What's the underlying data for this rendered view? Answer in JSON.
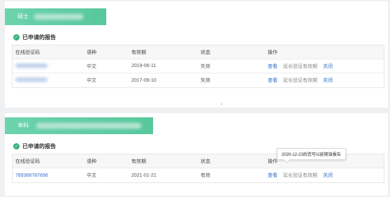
{
  "cards": [
    {
      "degree_label": "硕士",
      "section_title": "已申请的报告",
      "table": {
        "headers": [
          "在线验证码",
          "语种",
          "有效期",
          "状态",
          "操作"
        ],
        "rows": [
          {
            "code": "",
            "language": "中文",
            "valid_until": "2019-06-11",
            "status": "失效",
            "actions": [
              "查看",
              "延长验证有效期",
              "关闭"
            ]
          },
          {
            "code": "",
            "language": "中文",
            "valid_until": "2017-09-10",
            "status": "失效",
            "actions": [
              "查看",
              "延长验证有效期",
              "关闭"
            ]
          }
        ]
      }
    },
    {
      "degree_label": "本科·",
      "section_title": "已申请的报告",
      "table": {
        "headers": [
          "在线验证码",
          "语种",
          "有效期",
          "状态",
          "操作"
        ],
        "rows": [
          {
            "code": "789366787896",
            "language": "中文",
            "valid_until": "2021-01-21",
            "status": "有效",
            "actions": [
              "查看",
              "延长验证有效期",
              "关闭"
            ]
          }
        ]
      }
    }
  ],
  "tooltip": "2020-12-23后您可以延期该报告",
  "colors": {
    "accent": "#58c79c",
    "link": "#2f6fcb",
    "check": "#3bb37c"
  }
}
